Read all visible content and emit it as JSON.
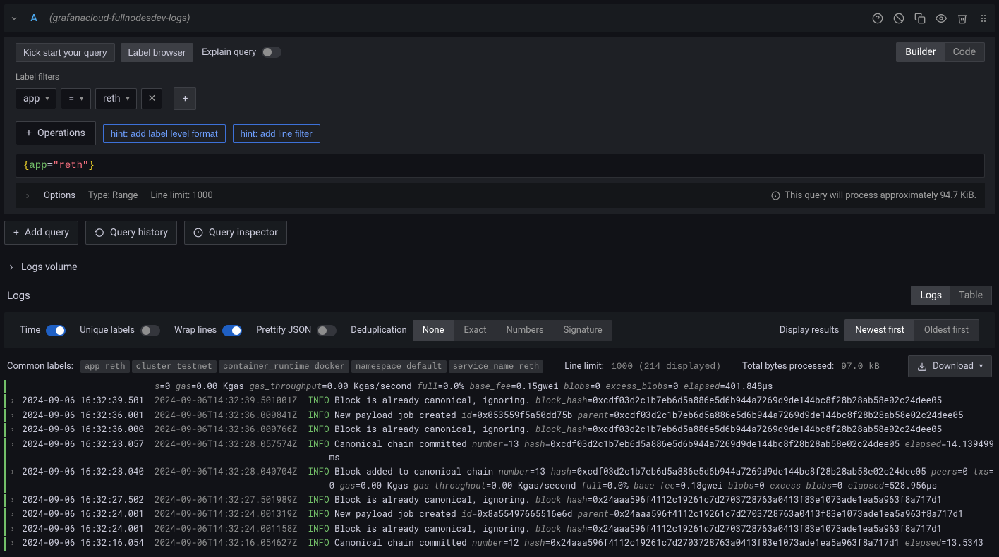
{
  "datasource_name": "(grafanacloud-fullnodesdev-logs)",
  "query_letter": "A",
  "toolbar": {
    "kick_start": "Kick start your query",
    "label_browser": "Label browser",
    "explain": "Explain query",
    "builder": "Builder",
    "code": "Code"
  },
  "label_filters_title": "Label filters",
  "filter": {
    "key": "app",
    "op": "=",
    "value": "reth"
  },
  "operations_btn": "Operations",
  "hints": {
    "level": "hint: add label level format",
    "line": "hint: add line filter"
  },
  "query_expr": {
    "lbrace": "{",
    "key": "app",
    "eq": "=",
    "quote": "\"",
    "val": "reth",
    "rbrace": "}"
  },
  "options": {
    "label": "Options",
    "type": "Type: Range",
    "line_limit": "Line limit: 1000",
    "info": "This query will process approximately 94.7 KiB."
  },
  "actions": {
    "add_query": "Add query",
    "history": "Query history",
    "inspector": "Query inspector"
  },
  "logs_volume": "Logs volume",
  "logs_title": "Logs",
  "view_tabs": {
    "logs": "Logs",
    "table": "Table"
  },
  "controls": {
    "time": "Time",
    "unique": "Unique labels",
    "wrap": "Wrap lines",
    "prettify": "Prettify JSON",
    "dedup_label": "Deduplication",
    "dedup": [
      "None",
      "Exact",
      "Numbers",
      "Signature"
    ],
    "disp_label": "Display results",
    "disp": [
      "Newest first",
      "Oldest first"
    ]
  },
  "common": {
    "label": "Common labels:",
    "tags": [
      "app=reth",
      "cluster=testnet",
      "container_runtime=docker",
      "namespace=default",
      "service_name=reth"
    ],
    "line_limit_label": "Line limit:",
    "line_limit_value": "1000 (214 displayed)",
    "tbp_label": "Total bytes processed:",
    "tbp_value": "97.0 kB",
    "download": "Download"
  },
  "log_lines": [
    {
      "ts": "",
      "ts2": "",
      "lvl": "",
      "segments": [
        {
          "k": "s",
          "v": "=0 "
        },
        {
          "k": "gas",
          "v": "=0.00 Kgas "
        },
        {
          "k": "gas_throughput",
          "v": "=0.00 Kgas/second "
        },
        {
          "k": "full",
          "v": "=0.0% "
        },
        {
          "k": "base_fee",
          "v": "=0.15gwei "
        },
        {
          "k": "blobs",
          "v": "=0 "
        },
        {
          "k": "excess_blobs",
          "v": "=0 "
        },
        {
          "k": "elapsed",
          "v": "=401.848µs"
        }
      ],
      "partial": true
    },
    {
      "ts": "2024-09-06 16:32:39.501",
      "ts2": "2024-09-06T14:32:39.501001Z",
      "lvl": "INFO",
      "msg": " Block is already canonical, ignoring. ",
      "segments": [
        {
          "k": "block_hash",
          "v": "=0xcdf03d2c1b7eb6d5a886e5d6b944a7269d9de144bc8f28b28ab58e02c24dee05"
        }
      ]
    },
    {
      "ts": "2024-09-06 16:32:36.001",
      "ts2": "2024-09-06T14:32:36.000841Z",
      "lvl": "INFO",
      "msg": " New payload job created ",
      "segments": [
        {
          "k": "id",
          "v": "=0x053559f5a50dd75b "
        },
        {
          "k": "parent",
          "v": "=0xcdf03d2c1b7eb6d5a886e5d6b944a7269d9de144bc8f28b28ab58e02c24dee05"
        }
      ]
    },
    {
      "ts": "2024-09-06 16:32:36.000",
      "ts2": "2024-09-06T14:32:36.000766Z",
      "lvl": "INFO",
      "msg": " Block is already canonical, ignoring. ",
      "segments": [
        {
          "k": "block_hash",
          "v": "=0xcdf03d2c1b7eb6d5a886e5d6b944a7269d9de144bc8f28b28ab58e02c24dee05"
        }
      ]
    },
    {
      "ts": "2024-09-06 16:32:28.057",
      "ts2": "2024-09-06T14:32:28.057574Z",
      "lvl": "INFO",
      "msg": " Canonical chain committed ",
      "segments": [
        {
          "k": "number",
          "v": "=13 "
        },
        {
          "k": "hash",
          "v": "=0xcdf03d2c1b7eb6d5a886e5d6b944a7269d9de144bc8f28b28ab58e02c24dee05 "
        },
        {
          "k": "elapsed",
          "v": "=14.139499ms"
        }
      ]
    },
    {
      "ts": "2024-09-06 16:32:28.040",
      "ts2": "2024-09-06T14:32:28.040704Z",
      "lvl": "INFO",
      "msg": " Block added to canonical chain ",
      "segments": [
        {
          "k": "number",
          "v": "=13 "
        },
        {
          "k": "hash",
          "v": "=0xcdf03d2c1b7eb6d5a886e5d6b944a7269d9de144bc8f28b28ab58e02c24dee05 "
        },
        {
          "k": "peers",
          "v": "=0 "
        },
        {
          "k": "txs",
          "v": "=0 "
        },
        {
          "k": "gas",
          "v": "=0.00 Kgas "
        },
        {
          "k": "gas_throughput",
          "v": "=0.00 Kgas/second "
        },
        {
          "k": "full",
          "v": "=0.0% "
        },
        {
          "k": "base_fee",
          "v": "=0.18gwei "
        },
        {
          "k": "blobs",
          "v": "=0 "
        },
        {
          "k": "excess_blobs",
          "v": "=0 "
        },
        {
          "k": "elapsed",
          "v": "=528.956µs"
        }
      ]
    },
    {
      "ts": "2024-09-06 16:32:27.502",
      "ts2": "2024-09-06T14:32:27.501989Z",
      "lvl": "INFO",
      "msg": " Block is already canonical, ignoring. ",
      "segments": [
        {
          "k": "block_hash",
          "v": "=0x24aaa596f4112c19261c7d2703728763a0413f83e1073ade1ea5a963f8a717d1"
        }
      ]
    },
    {
      "ts": "2024-09-06 16:32:24.001",
      "ts2": "2024-09-06T14:32:24.001319Z",
      "lvl": "INFO",
      "msg": " New payload job created ",
      "segments": [
        {
          "k": "id",
          "v": "=0x8a55497665516e6d "
        },
        {
          "k": "parent",
          "v": "=0x24aaa596f4112c19261c7d2703728763a0413f83e1073ade1ea5a963f8a717d1"
        }
      ]
    },
    {
      "ts": "2024-09-06 16:32:24.001",
      "ts2": "2024-09-06T14:32:24.001158Z",
      "lvl": "INFO",
      "msg": " Block is already canonical, ignoring. ",
      "segments": [
        {
          "k": "block_hash",
          "v": "=0x24aaa596f4112c19261c7d2703728763a0413f83e1073ade1ea5a963f8a717d1"
        }
      ]
    },
    {
      "ts": "2024-09-06 16:32:16.054",
      "ts2": "2024-09-06T14:32:16.054627Z",
      "lvl": "INFO",
      "msg": " Canonical chain committed ",
      "segments": [
        {
          "k": "number",
          "v": "=12 "
        },
        {
          "k": "hash",
          "v": "=0x24aaa596f4112c19261c7d2703728763a0413f83e1073ade1ea5a963f8a717d1 "
        },
        {
          "k": "elapsed",
          "v": "=13.5343"
        }
      ]
    }
  ]
}
